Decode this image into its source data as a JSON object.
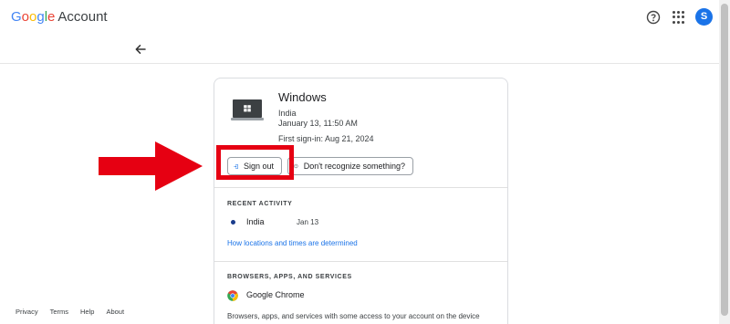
{
  "header": {
    "brand_letters": [
      "G",
      "o",
      "o",
      "g",
      "l",
      "e"
    ],
    "brand_word": "Account",
    "avatar_initial": "S",
    "icons": [
      "help-icon",
      "apps-grid-icon",
      "back-arrow-icon"
    ]
  },
  "device": {
    "name": "Windows",
    "location": "India",
    "last_seen": "January 13, 11:50 AM",
    "first_signin": "First sign-in: Aug 21, 2024",
    "signout_label": "Sign out",
    "dont_recognize_label": "Don't recognize something?"
  },
  "recent_activity": {
    "heading": "RECENT ACTIVITY",
    "items": [
      {
        "location": "India",
        "date": "Jan 13"
      }
    ],
    "link_label": "How locations and times are determined"
  },
  "services": {
    "heading": "BROWSERS, APPS, AND SERVICES",
    "items": [
      {
        "label": "Google Chrome",
        "icon": "chrome-icon"
      }
    ],
    "description": "Browsers, apps, and services with some access to your account on the device"
  },
  "footer": {
    "links": [
      "Privacy",
      "Terms",
      "Help",
      "About"
    ]
  },
  "colors": {
    "accent": "#1a73e8",
    "annotation_red": "#e60012"
  }
}
